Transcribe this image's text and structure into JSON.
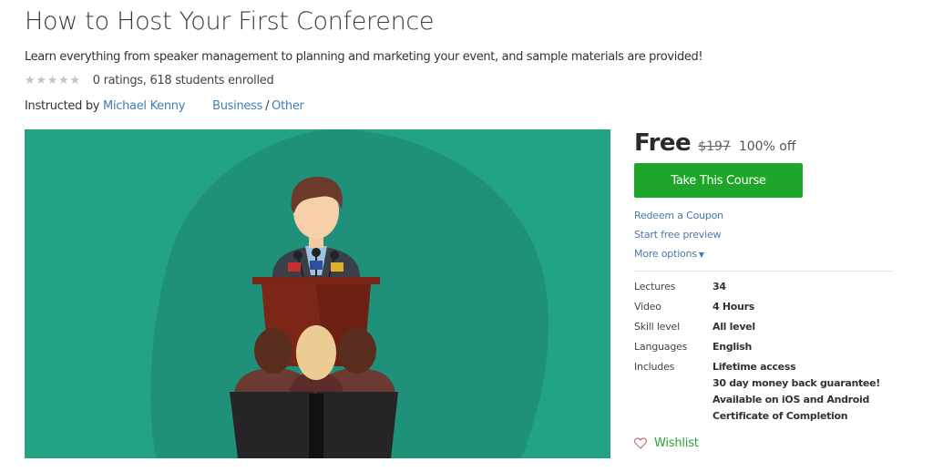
{
  "course": {
    "title": "How to Host Your First Conference",
    "subtitle": "Learn everything from speaker management to planning and marketing your event, and sample materials are provided!",
    "rating": {
      "stars_filled": 0,
      "stars_total": 5,
      "summary": "0 ratings, 618 students enrolled"
    },
    "instructor": {
      "prefix": "Instructed by",
      "name": "Michael Kenny"
    },
    "category": {
      "primary": "Business",
      "separator": "/",
      "secondary": "Other"
    },
    "hero_image": {
      "description": "Illustration of a speaker at a podium with microphones, audience seen from behind",
      "background_color": "#23a386"
    }
  },
  "purchase": {
    "price": "Free",
    "original_price": "$197",
    "discount": "100% off",
    "cta_label": "Take This Course",
    "cta_color": "#1fa52a",
    "links": {
      "redeem": "Redeem a Coupon",
      "preview": "Start free preview",
      "more": "More options"
    }
  },
  "details": {
    "rows": [
      {
        "label": "Lectures",
        "value": "34"
      },
      {
        "label": "Video",
        "value": "4 Hours"
      },
      {
        "label": "Skill level",
        "value": "All level"
      },
      {
        "label": "Languages",
        "value": "English"
      }
    ],
    "includes": {
      "label": "Includes",
      "items": [
        "Lifetime access",
        "30 day money back guarantee!",
        "Available on iOS and Android",
        "Certificate of Completion"
      ]
    }
  },
  "wishlist": {
    "label": "Wishlist",
    "icon": "heart-outline-icon"
  },
  "colors": {
    "link": "#3f7fb5",
    "accent_green": "#1fa52a",
    "wishlist_green": "#27a035"
  }
}
